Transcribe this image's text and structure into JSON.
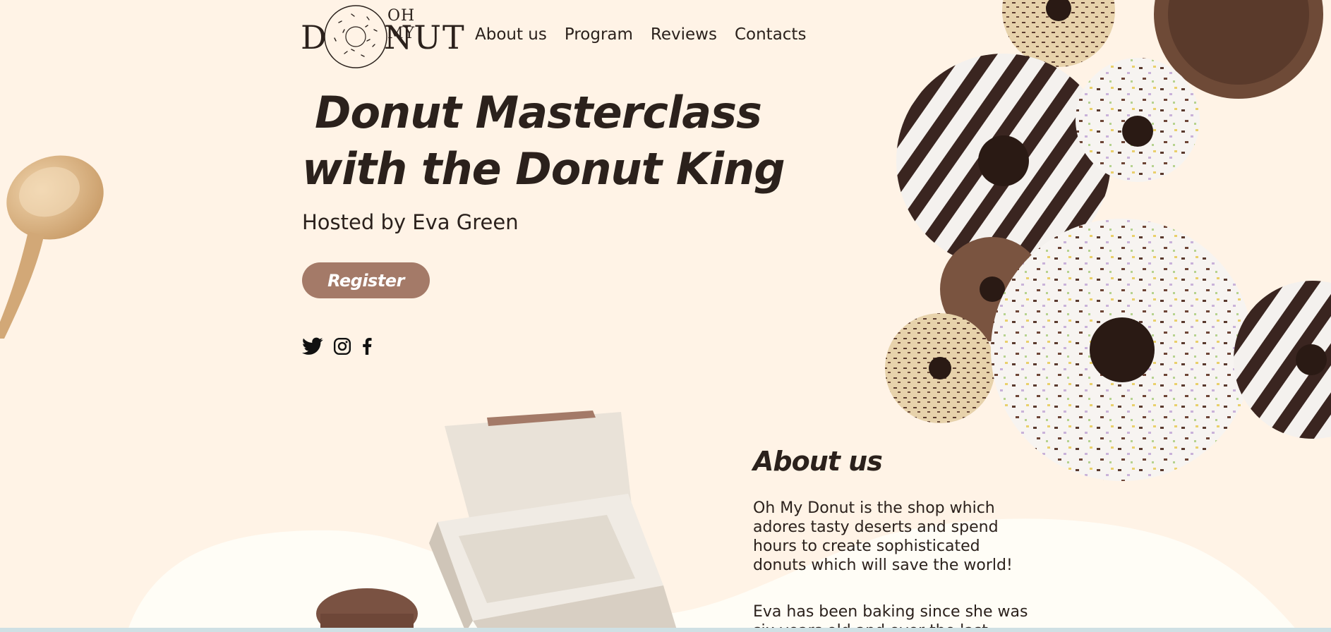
{
  "logo": {
    "top_text": "OH MY",
    "d": "D",
    "nut": "NUT",
    "alt": "Oh My Donut"
  },
  "nav": {
    "items": [
      "About us",
      "Program",
      "Reviews",
      "Contacts"
    ]
  },
  "hero": {
    "title_line1": "Donut Masterclass",
    "title_line2": "with the Donut King",
    "subtitle": "Hosted by Eva Green",
    "register_label": "Register"
  },
  "socials": {
    "icons": [
      "twitter-icon",
      "instagram-icon",
      "facebook-icon"
    ]
  },
  "about": {
    "heading": "About us",
    "paragraph1": "Oh My Donut is the shop which adores tasty deserts and spend hours to create sophisticated donuts which will save the world!",
    "paragraph2": "Eva has been baking since she was six years old and over the last"
  },
  "colors": {
    "background": "#fff3e6",
    "wave": "#fffdf6",
    "button": "#a47a68",
    "text": "#2b211c"
  }
}
